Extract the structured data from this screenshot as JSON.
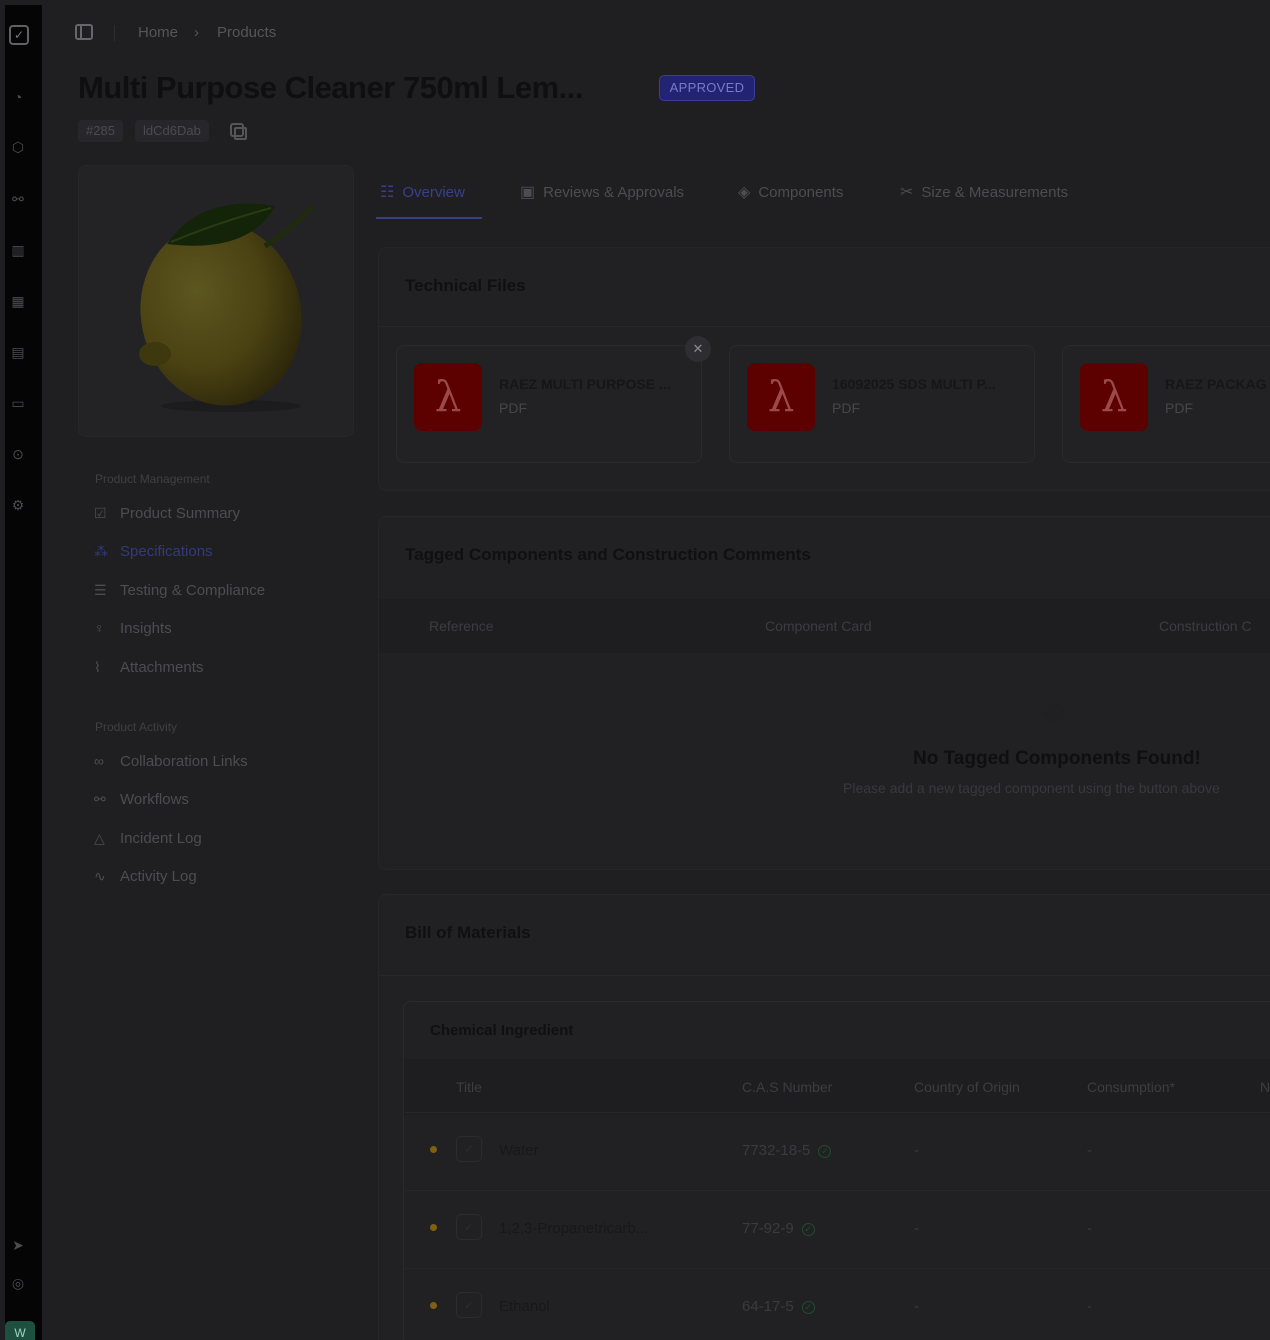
{
  "breadcrumb": [
    "Home",
    "Products"
  ],
  "product": {
    "title": "Multi Purpose Cleaner 750ml Lem...",
    "status": "APPROVED",
    "number": "#285",
    "code": "ldCd6Dab"
  },
  "nav": {
    "management_heading": "Product Management",
    "management": [
      "Product Summary",
      "Specifications",
      "Testing & Compliance",
      "Insights",
      "Attachments"
    ],
    "activity_heading": "Product Activity",
    "activity": [
      "Collaboration Links",
      "Workflows",
      "Incident Log",
      "Activity Log"
    ]
  },
  "tabs": [
    "Overview",
    "Reviews & Approvals",
    "Components",
    "Size & Measurements"
  ],
  "technical_files": {
    "title": "Technical Files",
    "files": [
      {
        "name": "RAEZ MULTI PURPOSE ...",
        "type": "PDF"
      },
      {
        "name": "16092025 SDS MULTI P...",
        "type": "PDF"
      },
      {
        "name": "RAEZ PACKAG",
        "type": "PDF"
      }
    ]
  },
  "tagged": {
    "title": "Tagged Components and Construction Comments",
    "columns": [
      "Reference",
      "Component Card",
      "Construction C"
    ],
    "empty_title": "No Tagged Components Found!",
    "empty_subtitle": "Please add a new tagged component using the button above"
  },
  "bom": {
    "title": "Bill of Materials",
    "subtitle": "Chemical Ingredient",
    "columns": [
      "Title",
      "C.A.S Number",
      "Country of Origin",
      "Consumption*",
      "N"
    ],
    "rows": [
      {
        "title": "Water",
        "cas": "7732-18-5",
        "origin": "-",
        "consumption": "-"
      },
      {
        "title": "1,2,3-Propanetricarb...",
        "cas": "77-92-9",
        "origin": "-",
        "consumption": "-"
      },
      {
        "title": "Ethanol",
        "cas": "64-17-5",
        "origin": "-",
        "consumption": "-"
      }
    ]
  },
  "user": {
    "initials": "W"
  }
}
